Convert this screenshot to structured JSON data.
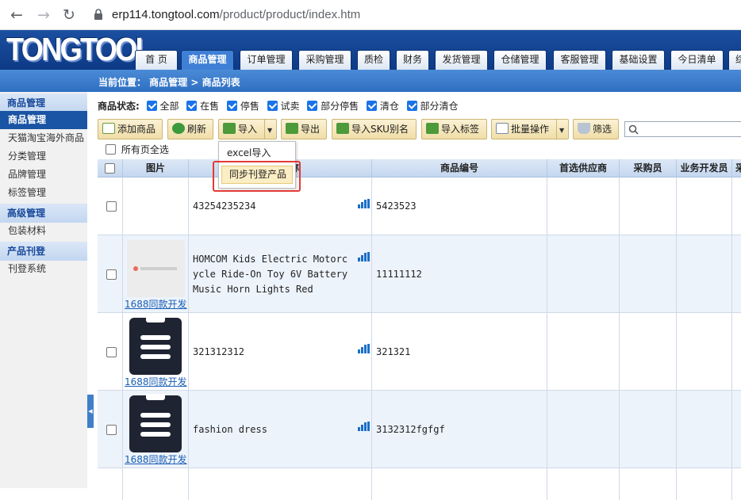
{
  "browser": {
    "url_host": "erp114.tongtool.com",
    "url_path": "/product/product/index.htm"
  },
  "logo": "TONGTOOL",
  "main_tabs": [
    "首 页",
    "商品管理",
    "订单管理",
    "采购管理",
    "质检",
    "财务",
    "发货管理",
    "仓储管理",
    "客服管理",
    "基础设置",
    "今日清单",
    "综"
  ],
  "active_tab": "商品管理",
  "breadcrumb": "当前位置： 商品管理 > 商品列表",
  "sidebar": {
    "groups": [
      {
        "title": "商品管理",
        "items": [
          "商品管理",
          "天猫淘宝海外商品",
          "分类管理",
          "品牌管理",
          "标签管理"
        ]
      },
      {
        "title": "高级管理",
        "items": [
          "包装材料"
        ]
      },
      {
        "title": "产品刊登",
        "items": [
          "刊登系统"
        ]
      }
    ],
    "active_item": "商品管理"
  },
  "status_filter": {
    "label": "商品状态:",
    "options": [
      "全部",
      "在售",
      "停售",
      "试卖",
      "部分停售",
      "清仓",
      "部分清仓"
    ]
  },
  "toolbar": {
    "add": "添加商品",
    "refresh": "刷新",
    "import": "导入",
    "export": "导出",
    "import_sku_alias": "导入SKU别名",
    "import_tag": "导入标签",
    "batch": "批量操作",
    "filter": "筛选"
  },
  "import_menu": {
    "excel": "excel导入",
    "sync": "同步刊登产品"
  },
  "select_all_pages": "所有页全选",
  "table": {
    "columns": [
      "图片",
      "商品名称",
      "商品编号",
      "首选供应商",
      "采购员",
      "业务开发员",
      "采"
    ],
    "rows": [
      {
        "name": "43254235234",
        "code": "5423523",
        "has_image": false,
        "link": ""
      },
      {
        "name": "HOMCOM Kids Electric Motorcycle Ride-On Toy 6V Battery Music Horn Lights Red",
        "code": "11111112",
        "has_image": true,
        "link": "1688同款开发"
      },
      {
        "name": "321312312",
        "code": "321321",
        "has_image": true,
        "link": "1688同款开发"
      },
      {
        "name": "fashion dress",
        "code": "3132312fgfgf",
        "has_image": true,
        "link": "1688同款开发"
      }
    ]
  },
  "colors": {
    "header_blue": "#1b4fa0",
    "active_tab": "#3f80d6",
    "sidebar_active": "#1a54a4",
    "toolbar_button": "#f3e3b4",
    "highlight_red": "#e53935",
    "link_blue": "#1a5fb4"
  }
}
